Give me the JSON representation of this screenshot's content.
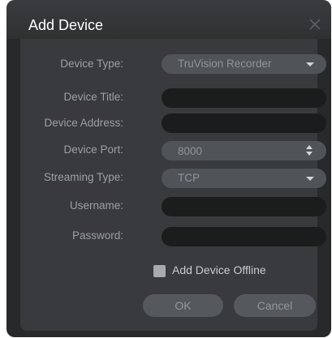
{
  "dialog": {
    "title": "Add Device",
    "close_icon": "close-icon"
  },
  "form": {
    "device_type": {
      "label": "Device Type:",
      "value": "TruVision Recorder"
    },
    "device_title": {
      "label": "Device Title:",
      "value": ""
    },
    "device_address": {
      "label": "Device Address:",
      "value": ""
    },
    "device_port": {
      "label": "Device Port:",
      "value": "8000"
    },
    "streaming_type": {
      "label": "Streaming Type:",
      "value": "TCP"
    },
    "username": {
      "label": "Username:",
      "value": ""
    },
    "password": {
      "label": "Password:",
      "value": ""
    }
  },
  "offline": {
    "label": "Add Device Offline",
    "checked": false
  },
  "buttons": {
    "ok": "OK",
    "cancel": "Cancel"
  },
  "colors": {
    "dialog_bg": "#27292b",
    "panel_bg": "#383a3d",
    "select_bg": "#505458",
    "input_bg": "#1b1c1e",
    "label_text": "#9aa0a4"
  }
}
